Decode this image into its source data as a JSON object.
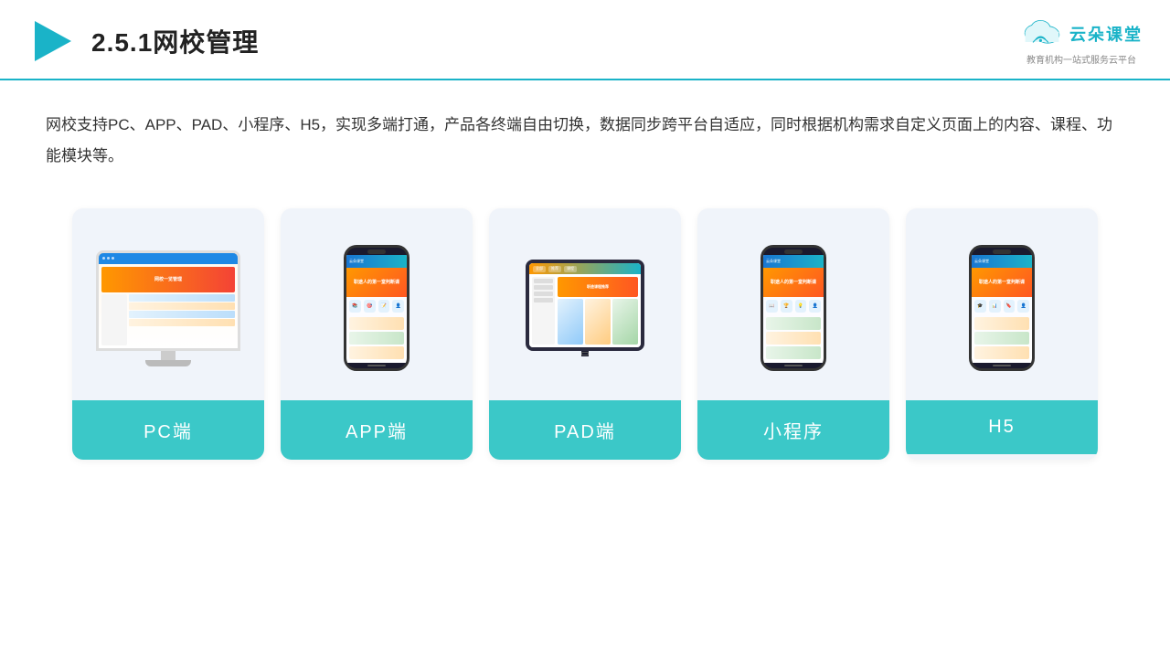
{
  "header": {
    "title": "2.5.1网校管理",
    "logo_text": "云朵课堂",
    "logo_url": "yunduoketang.com",
    "logo_sub": "教育机构一站式服务云平台"
  },
  "description": {
    "text": "网校支持PC、APP、PAD、小程序、H5，实现多端打通，产品各终端自由切换，数据同步跨平台自适应，同时根据机构需求自定义页面上的内容、课程、功能模块等。"
  },
  "cards": [
    {
      "id": "pc",
      "label": "PC端"
    },
    {
      "id": "app",
      "label": "APP端"
    },
    {
      "id": "pad",
      "label": "PAD端"
    },
    {
      "id": "miniapp",
      "label": "小程序"
    },
    {
      "id": "h5",
      "label": "H5"
    }
  ],
  "colors": {
    "teal": "#3bc8c8",
    "accent_blue": "#1ab3c8",
    "border_bottom": "#1ab3c8"
  }
}
